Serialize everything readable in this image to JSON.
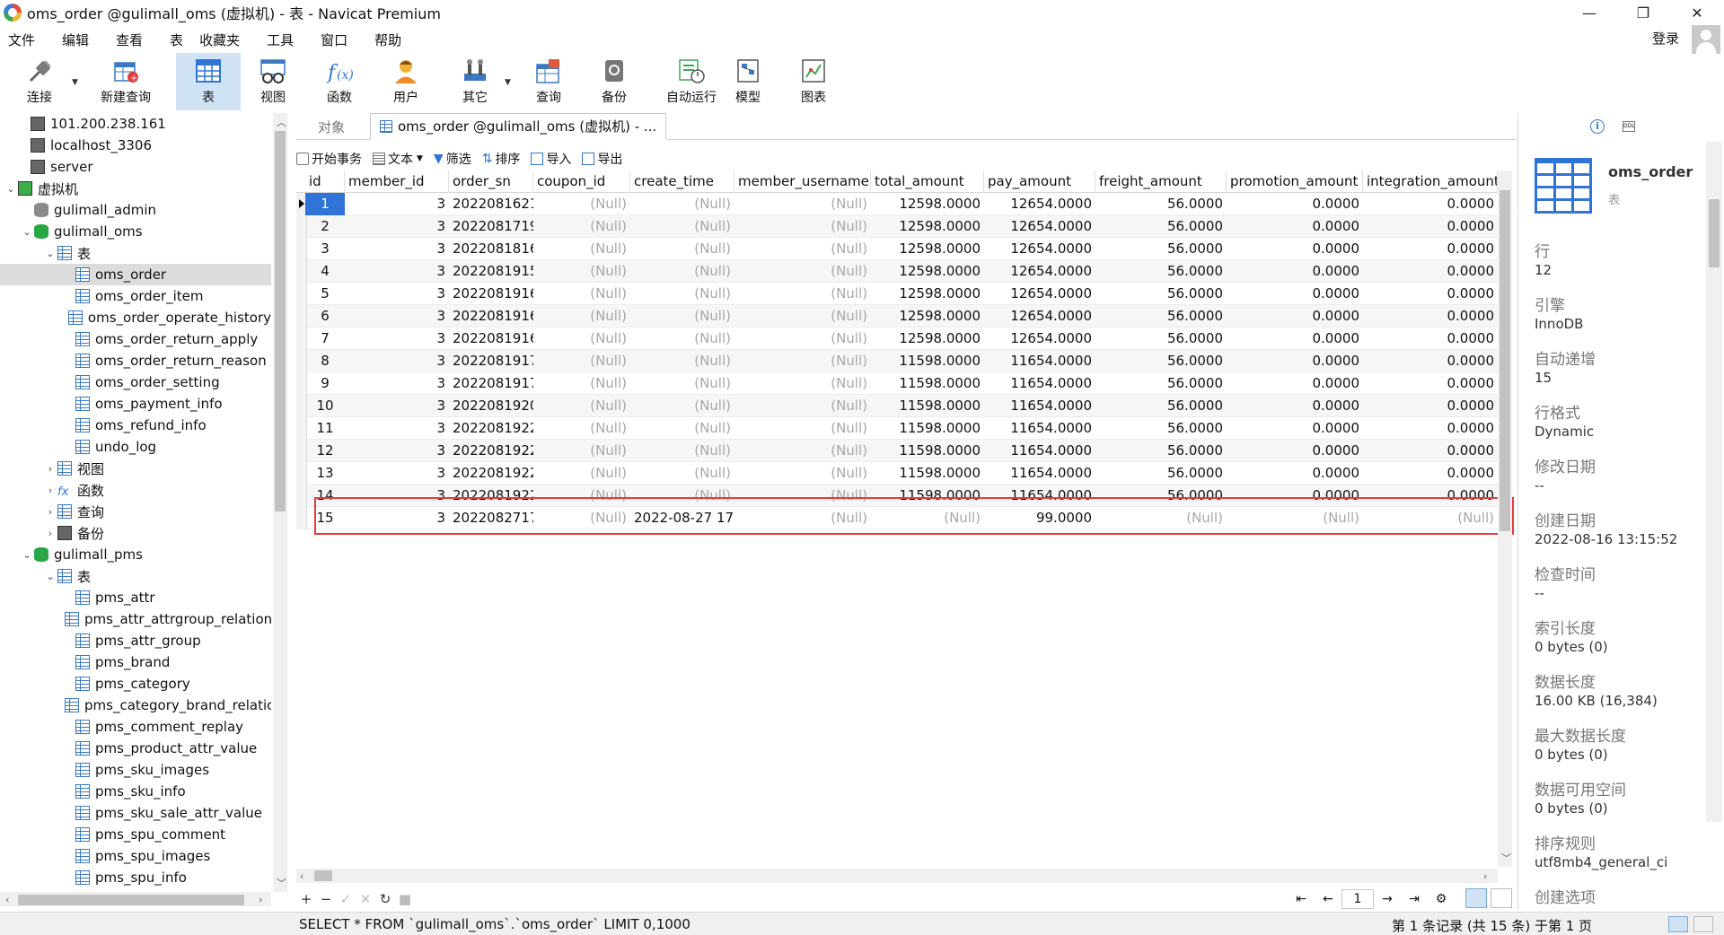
{
  "window": {
    "title": "oms_order @gulimall_oms (虚拟机) - 表 - Navicat Premium",
    "minimize": "—",
    "restore": "❐",
    "close": "✕"
  },
  "menu": [
    "文件",
    "编辑",
    "查看",
    "表",
    "收藏夹",
    "工具",
    "窗口",
    "帮助"
  ],
  "login": "登录",
  "toolbar": [
    {
      "label": "连接",
      "icon": "plug-icon"
    },
    {
      "label": "新建查询",
      "icon": "new-query-icon"
    },
    {
      "label": "表",
      "icon": "table-icon",
      "active": true
    },
    {
      "label": "视图",
      "icon": "view-icon"
    },
    {
      "label": "函数",
      "icon": "function-icon"
    },
    {
      "label": "用户",
      "icon": "user-icon"
    },
    {
      "label": "其它",
      "icon": "tools-icon"
    },
    {
      "label": "查询",
      "icon": "query-icon"
    },
    {
      "label": "备份",
      "icon": "backup-icon"
    },
    {
      "label": "自动运行",
      "icon": "schedule-icon"
    },
    {
      "label": "模型",
      "icon": "model-icon"
    },
    {
      "label": "图表",
      "icon": "chart-icon"
    }
  ],
  "tree": [
    {
      "label": "101.200.238.161",
      "icon": "server",
      "toggle": ""
    },
    {
      "label": "localhost_3306",
      "icon": "server",
      "toggle": ""
    },
    {
      "label": "server",
      "icon": "server",
      "toggle": ""
    },
    {
      "label": "虚拟机",
      "icon": "server-green",
      "toggle": "⌄"
    },
    {
      "label": "gulimall_admin",
      "icon": "db-gray",
      "toggle": ""
    },
    {
      "label": "gulimall_oms",
      "icon": "db",
      "toggle": "⌄"
    },
    {
      "label": "表",
      "icon": "table",
      "toggle": "⌄"
    },
    {
      "label": "oms_order",
      "icon": "table",
      "toggle": "",
      "selected": true
    },
    {
      "label": "oms_order_item",
      "icon": "table",
      "toggle": ""
    },
    {
      "label": "oms_order_operate_history",
      "icon": "table",
      "toggle": ""
    },
    {
      "label": "oms_order_return_apply",
      "icon": "table",
      "toggle": ""
    },
    {
      "label": "oms_order_return_reason",
      "icon": "table",
      "toggle": ""
    },
    {
      "label": "oms_order_setting",
      "icon": "table",
      "toggle": ""
    },
    {
      "label": "oms_payment_info",
      "icon": "table",
      "toggle": ""
    },
    {
      "label": "oms_refund_info",
      "icon": "table",
      "toggle": ""
    },
    {
      "label": "undo_log",
      "icon": "table",
      "toggle": ""
    },
    {
      "label": "视图",
      "icon": "view",
      "toggle": "›"
    },
    {
      "label": "函数",
      "icon": "fx",
      "toggle": "›"
    },
    {
      "label": "查询",
      "icon": "query",
      "toggle": "›"
    },
    {
      "label": "备份",
      "icon": "backup",
      "toggle": "›"
    },
    {
      "label": "gulimall_pms",
      "icon": "db",
      "toggle": "⌄"
    },
    {
      "label": "表",
      "icon": "table",
      "toggle": "⌄"
    },
    {
      "label": "pms_attr",
      "icon": "table",
      "toggle": ""
    },
    {
      "label": "pms_attr_attrgroup_relation",
      "icon": "table",
      "toggle": ""
    },
    {
      "label": "pms_attr_group",
      "icon": "table",
      "toggle": ""
    },
    {
      "label": "pms_brand",
      "icon": "table",
      "toggle": ""
    },
    {
      "label": "pms_category",
      "icon": "table",
      "toggle": ""
    },
    {
      "label": "pms_category_brand_relation",
      "icon": "table",
      "toggle": ""
    },
    {
      "label": "pms_comment_replay",
      "icon": "table",
      "toggle": ""
    },
    {
      "label": "pms_product_attr_value",
      "icon": "table",
      "toggle": ""
    },
    {
      "label": "pms_sku_images",
      "icon": "table",
      "toggle": ""
    },
    {
      "label": "pms_sku_info",
      "icon": "table",
      "toggle": ""
    },
    {
      "label": "pms_sku_sale_attr_value",
      "icon": "table",
      "toggle": ""
    },
    {
      "label": "pms_spu_comment",
      "icon": "table",
      "toggle": ""
    },
    {
      "label": "pms_spu_images",
      "icon": "table",
      "toggle": ""
    },
    {
      "label": "pms_spu_info",
      "icon": "table",
      "toggle": ""
    }
  ],
  "tabs": {
    "objects": "对象",
    "active": "oms_order @gulimall_oms (虚拟机) - ..."
  },
  "subtoolbar": {
    "begin_tx": "开始事务",
    "text": "文本",
    "filter": "筛选",
    "sort": "排序",
    "import": "导入",
    "export": "导出"
  },
  "grid": {
    "columns": [
      "id",
      "member_id",
      "order_sn",
      "coupon_id",
      "create_time",
      "member_username",
      "total_amount",
      "pay_amount",
      "freight_amount",
      "promotion_amount",
      "integration_amount"
    ],
    "rows": [
      [
        "1",
        "3",
        "2022081621:",
        "(Null)",
        "(Null)",
        "(Null)",
        "12598.0000",
        "12654.0000",
        "56.0000",
        "0.0000",
        "0.0000"
      ],
      [
        "2",
        "3",
        "2022081719:",
        "(Null)",
        "(Null)",
        "(Null)",
        "12598.0000",
        "12654.0000",
        "56.0000",
        "0.0000",
        "0.0000"
      ],
      [
        "3",
        "3",
        "2022081816:",
        "(Null)",
        "(Null)",
        "(Null)",
        "12598.0000",
        "12654.0000",
        "56.0000",
        "0.0000",
        "0.0000"
      ],
      [
        "4",
        "3",
        "2022081915",
        "(Null)",
        "(Null)",
        "(Null)",
        "12598.0000",
        "12654.0000",
        "56.0000",
        "0.0000",
        "0.0000"
      ],
      [
        "5",
        "3",
        "2022081916",
        "(Null)",
        "(Null)",
        "(Null)",
        "12598.0000",
        "12654.0000",
        "56.0000",
        "0.0000",
        "0.0000"
      ],
      [
        "6",
        "3",
        "2022081916:",
        "(Null)",
        "(Null)",
        "(Null)",
        "12598.0000",
        "12654.0000",
        "56.0000",
        "0.0000",
        "0.0000"
      ],
      [
        "7",
        "3",
        "2022081916:",
        "(Null)",
        "(Null)",
        "(Null)",
        "12598.0000",
        "12654.0000",
        "56.0000",
        "0.0000",
        "0.0000"
      ],
      [
        "8",
        "3",
        "2022081917",
        "(Null)",
        "(Null)",
        "(Null)",
        "11598.0000",
        "11654.0000",
        "56.0000",
        "0.0000",
        "0.0000"
      ],
      [
        "9",
        "3",
        "2022081917:",
        "(Null)",
        "(Null)",
        "(Null)",
        "11598.0000",
        "11654.0000",
        "56.0000",
        "0.0000",
        "0.0000"
      ],
      [
        "10",
        "3",
        "2022081920",
        "(Null)",
        "(Null)",
        "(Null)",
        "11598.0000",
        "11654.0000",
        "56.0000",
        "0.0000",
        "0.0000"
      ],
      [
        "11",
        "3",
        "2022081922",
        "(Null)",
        "(Null)",
        "(Null)",
        "11598.0000",
        "11654.0000",
        "56.0000",
        "0.0000",
        "0.0000"
      ],
      [
        "12",
        "3",
        "2022081922",
        "(Null)",
        "(Null)",
        "(Null)",
        "11598.0000",
        "11654.0000",
        "56.0000",
        "0.0000",
        "0.0000"
      ],
      [
        "13",
        "3",
        "2022081922:",
        "(Null)",
        "(Null)",
        "(Null)",
        "11598.0000",
        "11654.0000",
        "56.0000",
        "0.0000",
        "0.0000"
      ],
      [
        "14",
        "3",
        "2022081922:",
        "(Null)",
        "(Null)",
        "(Null)",
        "11598.0000",
        "11654.0000",
        "56.0000",
        "0.0000",
        "0.0000"
      ],
      [
        "15",
        "3",
        "2022082717",
        "(Null)",
        "2022-08-27 17:",
        "(Null)",
        "(Null)",
        "99.0000",
        "(Null)",
        "(Null)",
        "(Null)"
      ]
    ]
  },
  "gridbar": {
    "add": "+",
    "remove": "−",
    "apply": "✓",
    "cancel": "✕",
    "refresh": "↻",
    "stop": "■",
    "first": "⇤",
    "prev": "←",
    "page": "1",
    "next": "→",
    "last": "⇥",
    "settings": "⚙"
  },
  "status": {
    "sql": "SELECT * FROM `gulimall_oms`.`oms_order` LIMIT 0,1000",
    "records": "第 1 条记录 (共 15 条) 于第 1 页"
  },
  "info": {
    "name": "oms_order",
    "type": "表",
    "props": [
      {
        "label": "行",
        "value": "12"
      },
      {
        "label": "引擎",
        "value": "InnoDB"
      },
      {
        "label": "自动递增",
        "value": "15"
      },
      {
        "label": "行格式",
        "value": "Dynamic"
      },
      {
        "label": "修改日期",
        "value": "--"
      },
      {
        "label": "创建日期",
        "value": "2022-08-16 13:15:52"
      },
      {
        "label": "检查时间",
        "value": "--"
      },
      {
        "label": "索引长度",
        "value": "0 bytes (0)"
      },
      {
        "label": "数据长度",
        "value": "16.00 KB (16,384)"
      },
      {
        "label": "最大数据长度",
        "value": "0 bytes (0)"
      },
      {
        "label": "数据可用空间",
        "value": "0 bytes (0)"
      },
      {
        "label": "排序规则",
        "value": "utf8mb4_general_ci"
      },
      {
        "label": "创建选项",
        "value": ""
      }
    ]
  },
  "colors": {
    "accent": "#2f74d6",
    "highlight": "#e23c3c",
    "null_text": "#a8a8a8"
  }
}
